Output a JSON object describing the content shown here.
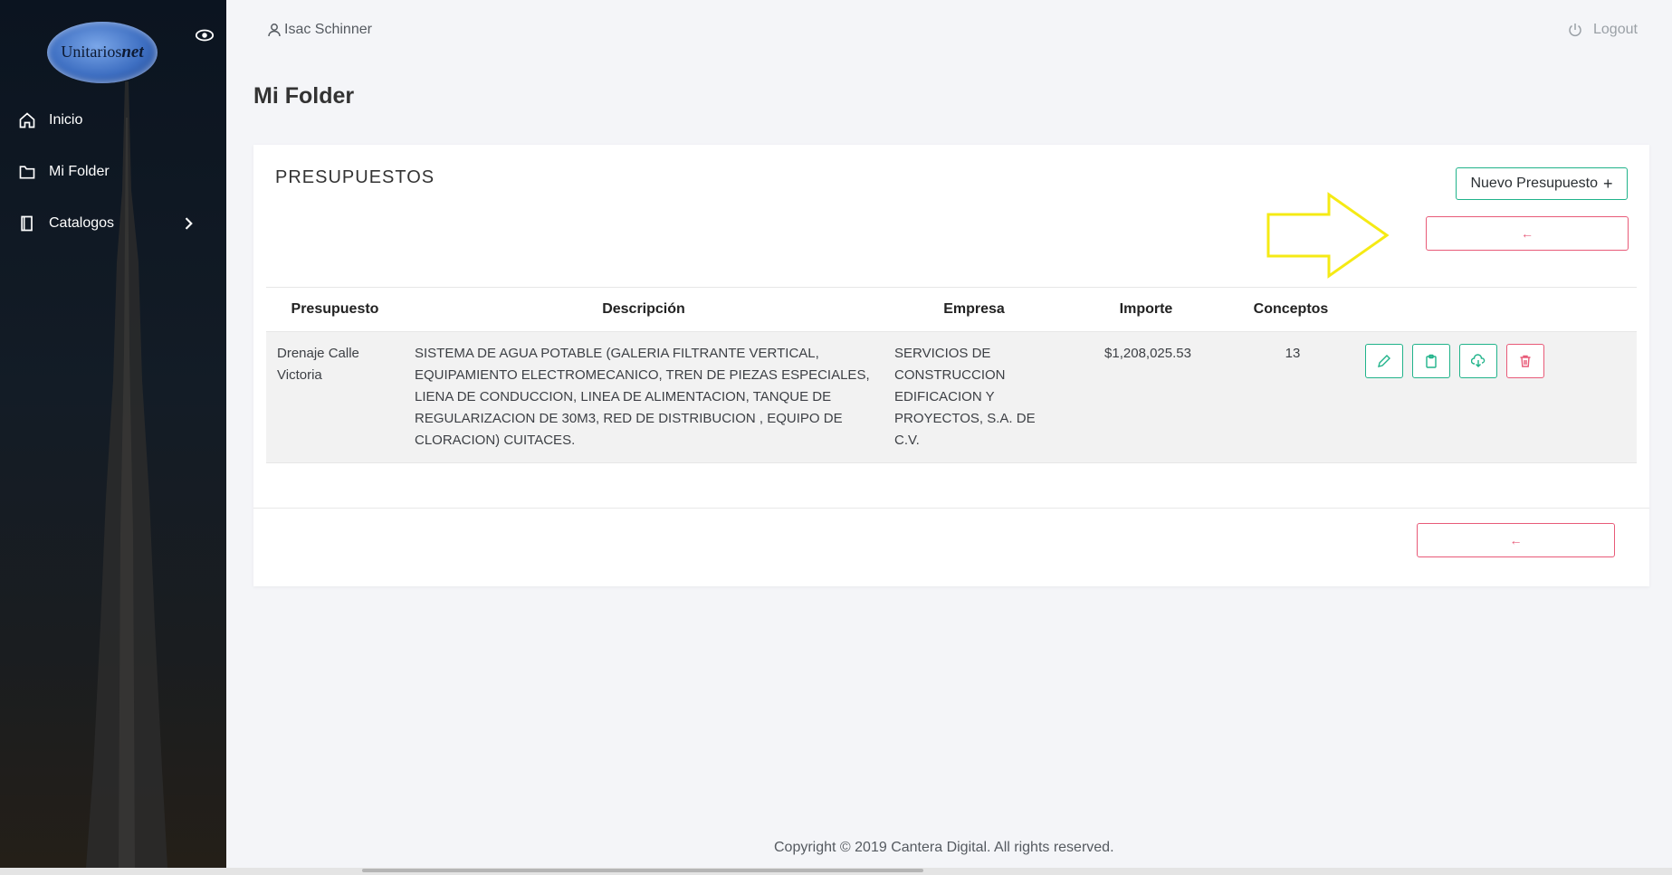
{
  "app": {
    "logo_text_main": "Unitarios",
    "logo_text_accent": "net"
  },
  "sidebar": {
    "items": [
      {
        "label": "Inicio",
        "icon": "home-icon"
      },
      {
        "label": "Mi Folder",
        "icon": "folder-icon"
      },
      {
        "label": "Catalogos",
        "icon": "book-icon"
      }
    ]
  },
  "header": {
    "user_name": "Isac Schinner",
    "logout_label": "Logout"
  },
  "page": {
    "title": "Mi Folder"
  },
  "card": {
    "title": "PRESUPUESTOS",
    "new_button_label": "Nuevo Presupuesto",
    "new_button_icon": "+",
    "back_button_icon": "←",
    "annotation_color": "#f5ea14"
  },
  "table": {
    "columns": [
      "Presupuesto",
      "Descripción",
      "Empresa",
      "Importe",
      "Conceptos"
    ],
    "rows": [
      {
        "presupuesto": "Drenaje Calle Victoria",
        "descripcion": "SISTEMA DE AGUA POTABLE (GALERIA FILTRANTE VERTICAL, EQUIPAMIENTO ELECTROMECANICO, TREN DE PIEZAS ESPECIALES, LIENA DE CONDUCCION, LINEA DE ALIMENTACION, TANQUE DE REGULARIZACION DE 30M3, RED DE DISTRIBUCION , EQUIPO DE CLORACION) CUITACES.",
        "empresa": "SERVICIOS DE CONSTRUCCION EDIFICACION Y PROYECTOS, S.A. DE C.V.",
        "importe": "$1,208,025.53",
        "conceptos": "13"
      }
    ]
  },
  "footer": {
    "copyright": "Copyright © 2019 Cantera Digital. All rights reserved."
  },
  "colors": {
    "accent_green": "#20b38a",
    "accent_red": "#e85a78",
    "sidebar_bg": "#0b1420"
  }
}
